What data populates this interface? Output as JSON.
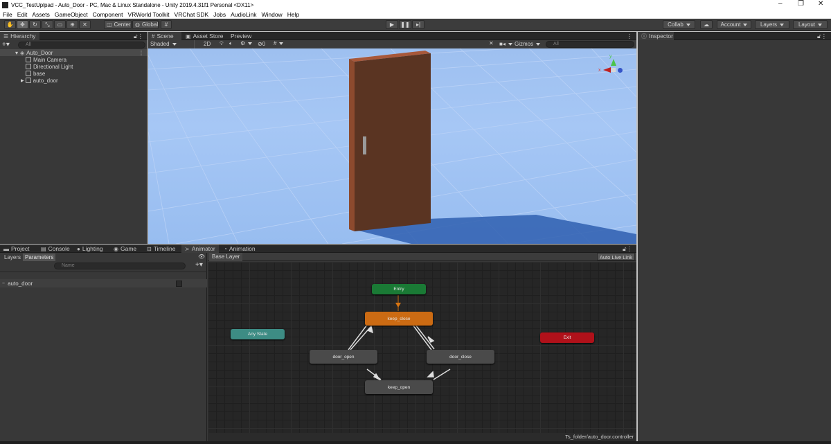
{
  "window": {
    "title": "VCC_TestUplpad - Auto_Door - PC, Mac & Linux Standalone - Unity 2019.4.31f1 Personal <DX11>",
    "controls": {
      "minimize": "–",
      "restore": "❐",
      "close": "✕"
    }
  },
  "menu": [
    "File",
    "Edit",
    "Assets",
    "GameObject",
    "Component",
    "VRWorld Toolkit",
    "VRChat SDK",
    "Jobs",
    "AudioLink",
    "Window",
    "Help"
  ],
  "toolbar": {
    "pivot": "Center",
    "space": "Global",
    "collab": "Collab",
    "account": "Account",
    "layers": "Layers",
    "layout": "Layout",
    "icons": {
      "hand": "hand-tool-icon",
      "move": "move-tool-icon",
      "rotate": "rotate-tool-icon",
      "scale": "scale-tool-icon",
      "rect": "rect-tool-icon",
      "transform": "transform-tool-icon",
      "custom": "custom-tool-icon",
      "grid": "grid-snap-icon",
      "play": "play-icon",
      "pause": "pause-icon",
      "step": "step-icon",
      "cloud": "cloud-icon"
    }
  },
  "hierarchy": {
    "tab": "Hierarchy",
    "search_placeholder": "All",
    "scene": "Auto_Door",
    "items": [
      "Main Camera",
      "Directional Light",
      "base",
      "auto_door"
    ]
  },
  "scene": {
    "tabs": [
      "Scene",
      "Asset Store",
      "Preview"
    ],
    "shading": "Shaded",
    "mode_2d": "2D",
    "fx_count": "0",
    "gizmos": "Gizmos",
    "search_placeholder": "All",
    "axis_labels": {
      "y": "y",
      "x": "x"
    }
  },
  "inspector": {
    "tab": "Inspector"
  },
  "bottom_tabs": [
    "Project",
    "Console",
    "Lighting",
    "Game",
    "Timeline",
    "Animator",
    "Animation"
  ],
  "animator": {
    "left_tabs": [
      "Layers",
      "Parameters"
    ],
    "param_search_placeholder": "Name",
    "parameters": [
      {
        "name": "auto_door",
        "type": "bool",
        "value": false
      }
    ],
    "breadcrumb": "Base Layer",
    "live_link": "Auto Live Link",
    "states": {
      "entry": "Entry",
      "any_state": "Any State",
      "exit": "Exit",
      "keep_close": "keep_close",
      "door_open": "door_open",
      "door_close": "door_close",
      "keep_open": "keep_open"
    },
    "asset_path": "Ts_folder/auto_door.controller",
    "colors": {
      "entry": "#1a7a35",
      "any_state": "#3d8c84",
      "exit": "#b0111a",
      "default_state": "#cc6b13",
      "state": "#4a4a4a"
    }
  }
}
